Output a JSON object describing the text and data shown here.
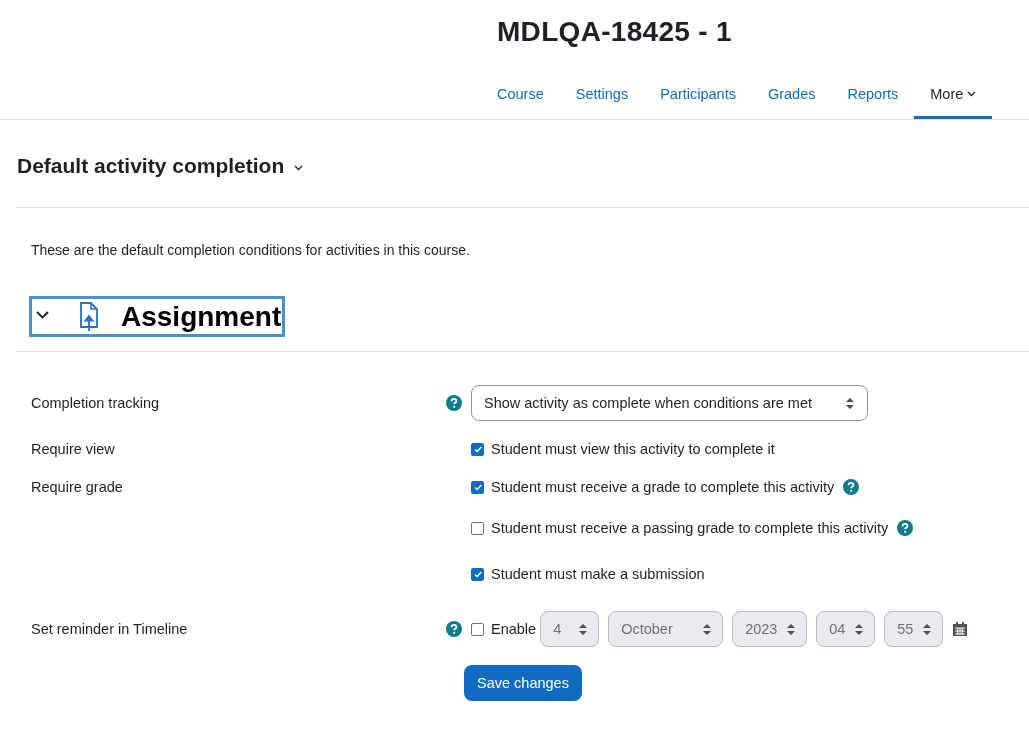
{
  "header": {
    "title": "MDLQA-18425 - 1"
  },
  "nav": [
    {
      "label": "Course",
      "selected": false
    },
    {
      "label": "Settings",
      "selected": false
    },
    {
      "label": "Participants",
      "selected": false
    },
    {
      "label": "Grades",
      "selected": false
    },
    {
      "label": "Reports",
      "selected": false
    },
    {
      "label": "More",
      "selected": true,
      "kind": "menu"
    }
  ],
  "page_heading": "Default activity completion",
  "intro": "These are the default completion conditions for activities in this course.",
  "section": {
    "title": "Assignment",
    "expanded": true
  },
  "rows": [
    {
      "kind": "select",
      "label": "Completion tracking",
      "help": true,
      "value": "Show activity as complete when conditions are met"
    },
    {
      "kind": "checkbox",
      "label": "Require view",
      "options": [
        {
          "text": "Student must view this activity to complete it",
          "checked": true,
          "help": false
        }
      ]
    },
    {
      "kind": "checkbox",
      "label": "Require grade",
      "options": [
        {
          "text": "Student must receive a grade to complete this activity",
          "checked": true,
          "help": true
        },
        {
          "text": "Student must receive a passing grade to complete this activity",
          "checked": false,
          "help": true
        }
      ]
    },
    {
      "kind": "checkbox",
      "options": [
        {
          "text": "Student must make a submission",
          "checked": true,
          "help": false
        }
      ]
    },
    {
      "kind": "date",
      "label": "Set reminder in Timeline",
      "help": true,
      "enable": {
        "label": "Enable",
        "checked": false
      },
      "fields": [
        {
          "value": "4",
          "disabled": true
        },
        {
          "value": "October",
          "disabled": true
        },
        {
          "value": "2023",
          "disabled": true
        },
        {
          "value": "04",
          "disabled": true
        },
        {
          "value": "55",
          "disabled": true
        }
      ]
    }
  ],
  "submit": "Save changes"
}
